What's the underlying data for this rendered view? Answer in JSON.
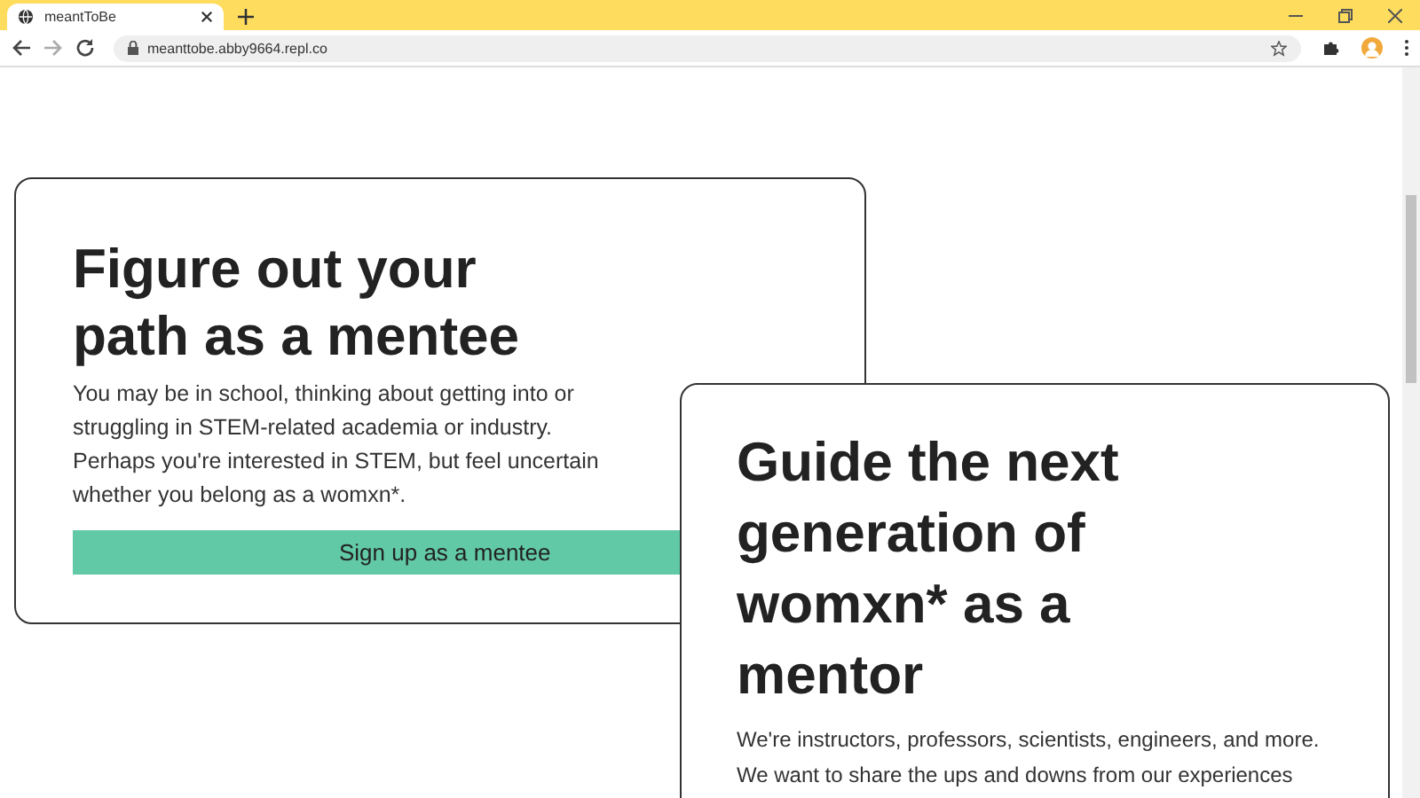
{
  "browser": {
    "tab_title": "meantToBe",
    "url": "meanttobe.abby9664.repl.co"
  },
  "mentee_card": {
    "heading": "Figure out your path as a mentee",
    "body": "You may be in school, thinking about getting into or struggling in STEM-related academia or industry. Perhaps you're interested in STEM, but feel uncertain whether you belong as a womxn*.",
    "button": "Sign up as a mentee"
  },
  "mentor_card": {
    "heading": "Guide the next generation of womxn* as a mentor",
    "body": "We're instructors, professors, scientists, engineers, and more. We want to share the ups and downs from our experiences"
  }
}
